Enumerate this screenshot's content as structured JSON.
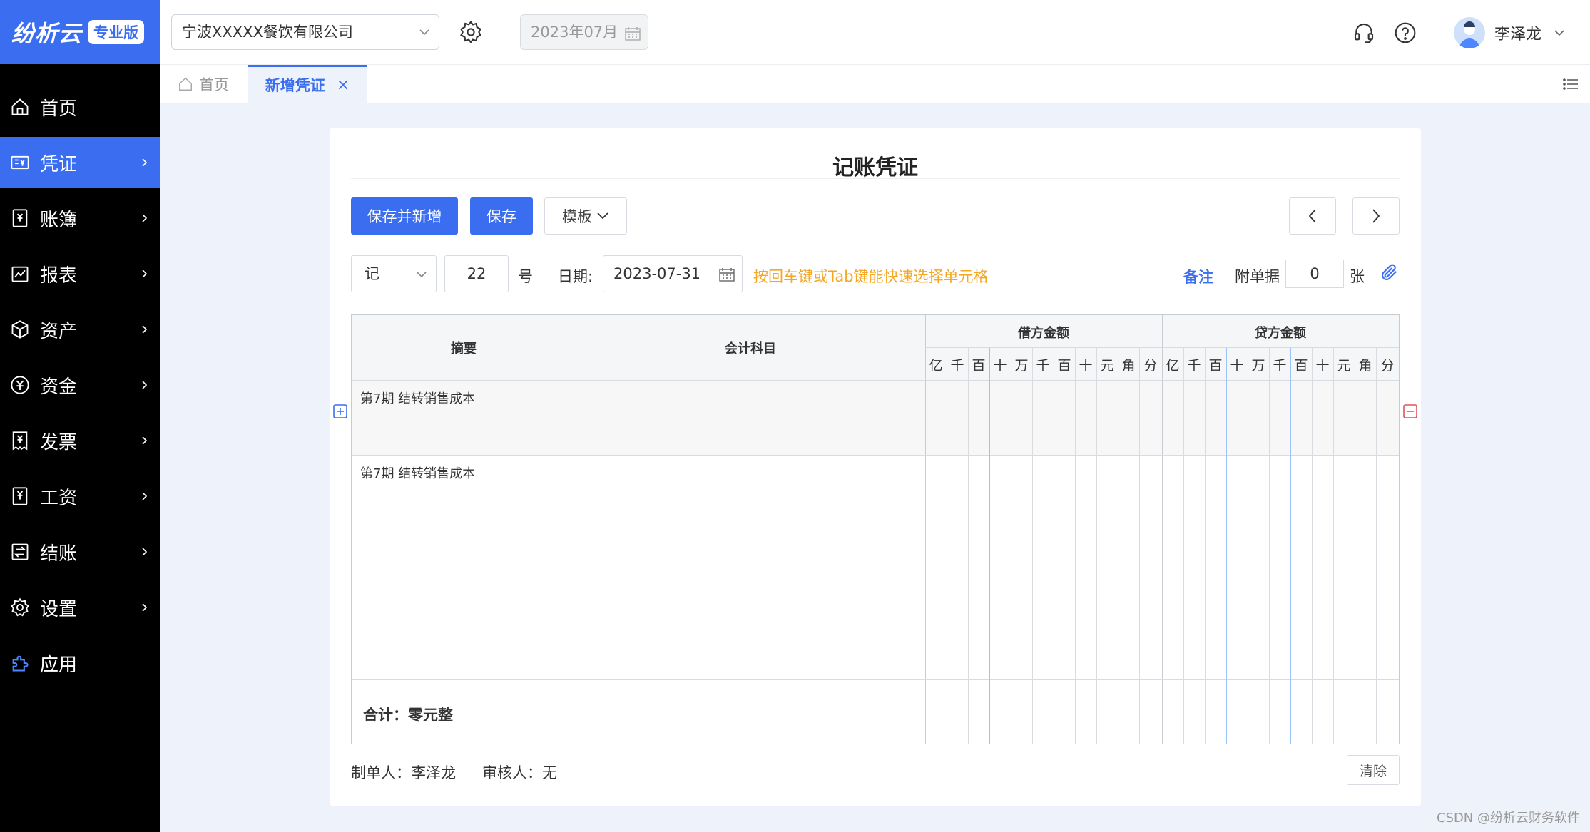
{
  "brand": {
    "name": "纷析云",
    "badge": "专业版"
  },
  "sidebar": {
    "items": [
      {
        "label": "首页",
        "icon": "home-icon"
      },
      {
        "label": "凭证",
        "icon": "voucher-icon"
      },
      {
        "label": "账簿",
        "icon": "ledger-icon"
      },
      {
        "label": "报表",
        "icon": "report-icon"
      },
      {
        "label": "资产",
        "icon": "asset-icon"
      },
      {
        "label": "资金",
        "icon": "fund-icon"
      },
      {
        "label": "发票",
        "icon": "invoice-icon"
      },
      {
        "label": "工资",
        "icon": "salary-icon"
      },
      {
        "label": "结账",
        "icon": "closing-icon"
      },
      {
        "label": "设置",
        "icon": "settings-icon"
      },
      {
        "label": "应用",
        "icon": "app-icon"
      }
    ],
    "active_index": 1,
    "accent": "#3a6df0"
  },
  "header": {
    "company": "宁波XXXXX餐饮有限公司",
    "period": "2023年07月",
    "user": "李泽龙"
  },
  "tabs": {
    "home": "首页",
    "current": "新增凭证",
    "close": "×"
  },
  "voucher": {
    "title": "记账凭证",
    "buttons": {
      "save_new": "保存并新增",
      "save": "保存",
      "template": "模板"
    },
    "word": "记",
    "number": "22",
    "number_suffix": "号",
    "date_label": "日期:",
    "date": "2023-07-31",
    "hint": "按回车键或Tab键能快速选择单元格",
    "remark": "备注",
    "attachment_label": "附单据",
    "attachment_count": "0",
    "attachment_unit": "张",
    "table": {
      "col_summary": "摘要",
      "col_account": "会计科目",
      "col_debit": "借方金额",
      "col_credit": "贷方金额",
      "units": [
        "亿",
        "千",
        "百",
        "十",
        "万",
        "千",
        "百",
        "十",
        "元",
        "角",
        "分"
      ],
      "rows": [
        {
          "summary": "第7期 结转销售成本",
          "account": ""
        },
        {
          "summary": "第7期 结转销售成本",
          "account": ""
        },
        {
          "summary": "",
          "account": ""
        },
        {
          "summary": "",
          "account": ""
        }
      ],
      "total": "合计：零元整"
    },
    "maker": "制单人：李泽龙",
    "reviewer": "审核人：无",
    "clear": "清除"
  },
  "watermark": "CSDN @纷析云财务软件"
}
